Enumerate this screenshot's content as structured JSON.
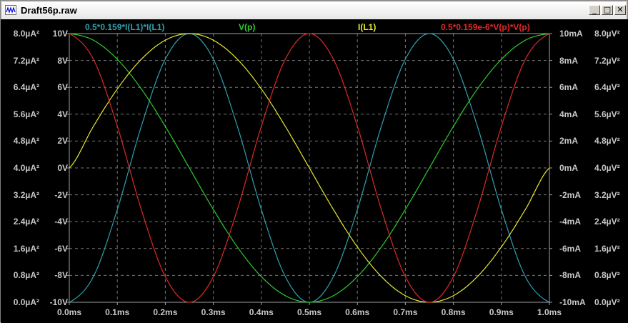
{
  "window": {
    "title": "Draft56p.raw",
    "minimize_label": "_",
    "maximize_label": "□",
    "close_label": "✕"
  },
  "chart_data": {
    "type": "line",
    "xlabel": "",
    "x_ticks": [
      "0.0ms",
      "0.1ms",
      "0.2ms",
      "0.3ms",
      "0.4ms",
      "0.5ms",
      "0.6ms",
      "0.7ms",
      "0.8ms",
      "0.9ms",
      "1.0ms"
    ],
    "xlim": [
      0,
      1.0
    ],
    "x_unit": "ms",
    "axes": {
      "left_outer": {
        "ticks": [
          "8.0µA²",
          "7.2µA²",
          "6.4µA²",
          "5.6µA²",
          "4.8µA²",
          "4.0µA²",
          "3.2µA²",
          "2.4µA²",
          "1.6µA²",
          "0.8µA²",
          "0.0µA²"
        ],
        "range": [
          0,
          8.0
        ],
        "unit": "µA²"
      },
      "left_inner": {
        "ticks": [
          "10V",
          "8V",
          "6V",
          "4V",
          "2V",
          "0V",
          "-2V",
          "-4V",
          "-6V",
          "-8V",
          "-10V"
        ],
        "range": [
          -10,
          10
        ],
        "unit": "V"
      },
      "right_inner": {
        "ticks": [
          "10mA",
          "8mA",
          "6mA",
          "4mA",
          "2mA",
          "0mA",
          "-2mA",
          "-4mA",
          "-6mA",
          "-8mA",
          "-10mA"
        ],
        "range": [
          -10,
          10
        ],
        "unit": "mA"
      },
      "right_outer": {
        "ticks": [
          "8.0µV²",
          "7.2µV²",
          "6.4µV²",
          "5.6µV²",
          "4.8µV²",
          "4.0µV²",
          "3.2µV²",
          "2.4µV²",
          "1.6µV²",
          "0.8µV²",
          "0.0µV²"
        ],
        "range": [
          0,
          8.0
        ],
        "unit": "µV²"
      }
    },
    "grid": true,
    "series": [
      {
        "name": "0.5*0.159*I(L1)*I(L1)",
        "color": "#2fa0ac",
        "axis": "left_outer",
        "x": [
          0,
          0.05,
          0.1,
          0.15,
          0.2,
          0.25,
          0.3,
          0.35,
          0.4,
          0.45,
          0.5,
          0.55,
          0.6,
          0.65,
          0.7,
          0.75,
          0.8,
          0.85,
          0.9,
          0.95,
          1.0
        ],
        "y": [
          0,
          0.76,
          2.76,
          5.24,
          7.24,
          8.0,
          7.24,
          5.24,
          2.76,
          0.76,
          0,
          0.76,
          2.76,
          5.24,
          7.24,
          8.0,
          7.24,
          5.24,
          2.76,
          0.76,
          0
        ]
      },
      {
        "name": "V(p)",
        "color": "#2ecc2e",
        "axis": "left_inner",
        "x": [
          0,
          0.05,
          0.1,
          0.15,
          0.2,
          0.25,
          0.3,
          0.35,
          0.4,
          0.45,
          0.5,
          0.55,
          0.6,
          0.65,
          0.7,
          0.75,
          0.8,
          0.85,
          0.9,
          0.95,
          1.0
        ],
        "y": [
          10,
          9.51,
          8.09,
          5.88,
          3.09,
          0,
          -3.09,
          -5.88,
          -8.09,
          -9.51,
          -10,
          -9.51,
          -8.09,
          -5.88,
          -3.09,
          0,
          3.09,
          5.88,
          8.09,
          9.51,
          10
        ]
      },
      {
        "name": "I(L1)",
        "color": "#e8e832",
        "axis": "right_inner",
        "x": [
          0,
          0.05,
          0.1,
          0.15,
          0.2,
          0.25,
          0.3,
          0.35,
          0.4,
          0.45,
          0.5,
          0.55,
          0.6,
          0.65,
          0.7,
          0.75,
          0.8,
          0.85,
          0.9,
          0.95,
          1.0
        ],
        "y": [
          0,
          3.09,
          5.88,
          8.09,
          9.51,
          10,
          9.51,
          8.09,
          5.88,
          3.09,
          0,
          -3.09,
          -5.88,
          -8.09,
          -9.51,
          -10,
          -9.51,
          -8.09,
          -5.88,
          -3.09,
          0
        ]
      },
      {
        "name": "0.5*0.159e-6*V(p)*V(p)",
        "color": "#e02828",
        "axis": "right_outer",
        "x": [
          0,
          0.05,
          0.1,
          0.15,
          0.2,
          0.25,
          0.3,
          0.35,
          0.4,
          0.45,
          0.5,
          0.55,
          0.6,
          0.65,
          0.7,
          0.75,
          0.8,
          0.85,
          0.9,
          0.95,
          1.0
        ],
        "y": [
          8.0,
          7.24,
          5.24,
          2.76,
          0.76,
          0,
          0.76,
          2.76,
          5.24,
          7.24,
          8.0,
          7.24,
          5.24,
          2.76,
          0.76,
          0,
          0.76,
          2.76,
          5.24,
          7.24,
          8.0
        ]
      }
    ],
    "legend_placement": "top"
  }
}
